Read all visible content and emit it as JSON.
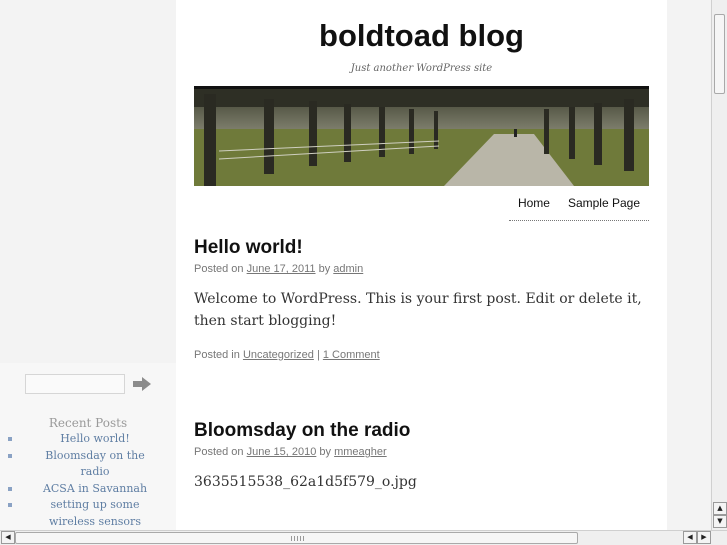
{
  "site": {
    "title": "boldtoad blog",
    "description": "Just another WordPress site"
  },
  "nav": {
    "items": [
      "Home",
      "Sample Page"
    ]
  },
  "posts": [
    {
      "title": "Hello world!",
      "posted_on": "Posted on",
      "date": "June 17, 2011",
      "by": "by",
      "author": "admin",
      "content": "Welcome to WordPress. This is your first post. Edit or delete it, then start blogging!",
      "posted_in": "Posted in",
      "category": "Uncategorized",
      "separator": "|",
      "comments": "1 Comment"
    },
    {
      "title": "Bloomsday on the radio",
      "posted_on": "Posted on",
      "date": "June 15, 2010",
      "by": "by",
      "author": "mmeagher",
      "content": "3635515538_62a1d5f579_o.jpg"
    }
  ],
  "sidebar": {
    "search_value": "",
    "recent_title": "Recent Posts",
    "recent_posts": [
      "Hello world!",
      "Bloomsday on the radio",
      "ACSA in Savannah",
      "setting up some wireless sensors"
    ]
  },
  "scrollbar": {
    "up": "▲",
    "down": "▼",
    "left": "◀",
    "right": "▶"
  },
  "colors": {
    "page_bg": "#f3f3f3",
    "content_bg": "#ffffff",
    "link": "#5f7ea3"
  }
}
